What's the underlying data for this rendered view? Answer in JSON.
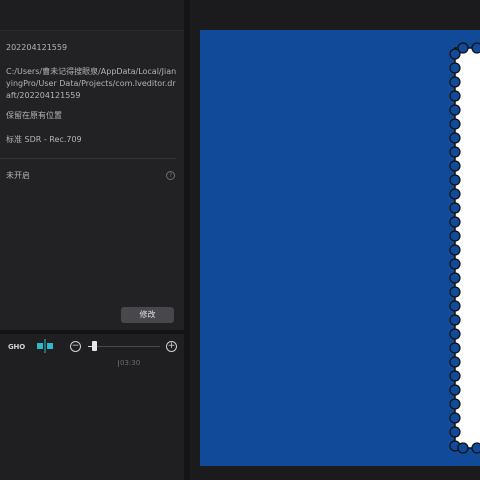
{
  "project_info": {
    "name": "202204121559",
    "path": "C:/Users/曹未记得搜眼泉/AppData/Local/JianyingPro/User Data/Projects/com.lveditor.draft/202204121559",
    "import_option": "保留在原有位置",
    "color_space": "标准 SDR - Rec.709",
    "status": "未开启"
  },
  "buttons": {
    "modify": "修改"
  },
  "timeline": {
    "gho_label": "GHO",
    "ruler_time": "03:30",
    "zoom_level": 0.08
  },
  "colors": {
    "canvas_bg": "#124a9a",
    "snap_accent": "#2fb8c8"
  },
  "icons": [
    "help-icon",
    "snap-icon",
    "zoom-out-icon",
    "zoom-in-icon",
    "stamp-frame-icon"
  ]
}
